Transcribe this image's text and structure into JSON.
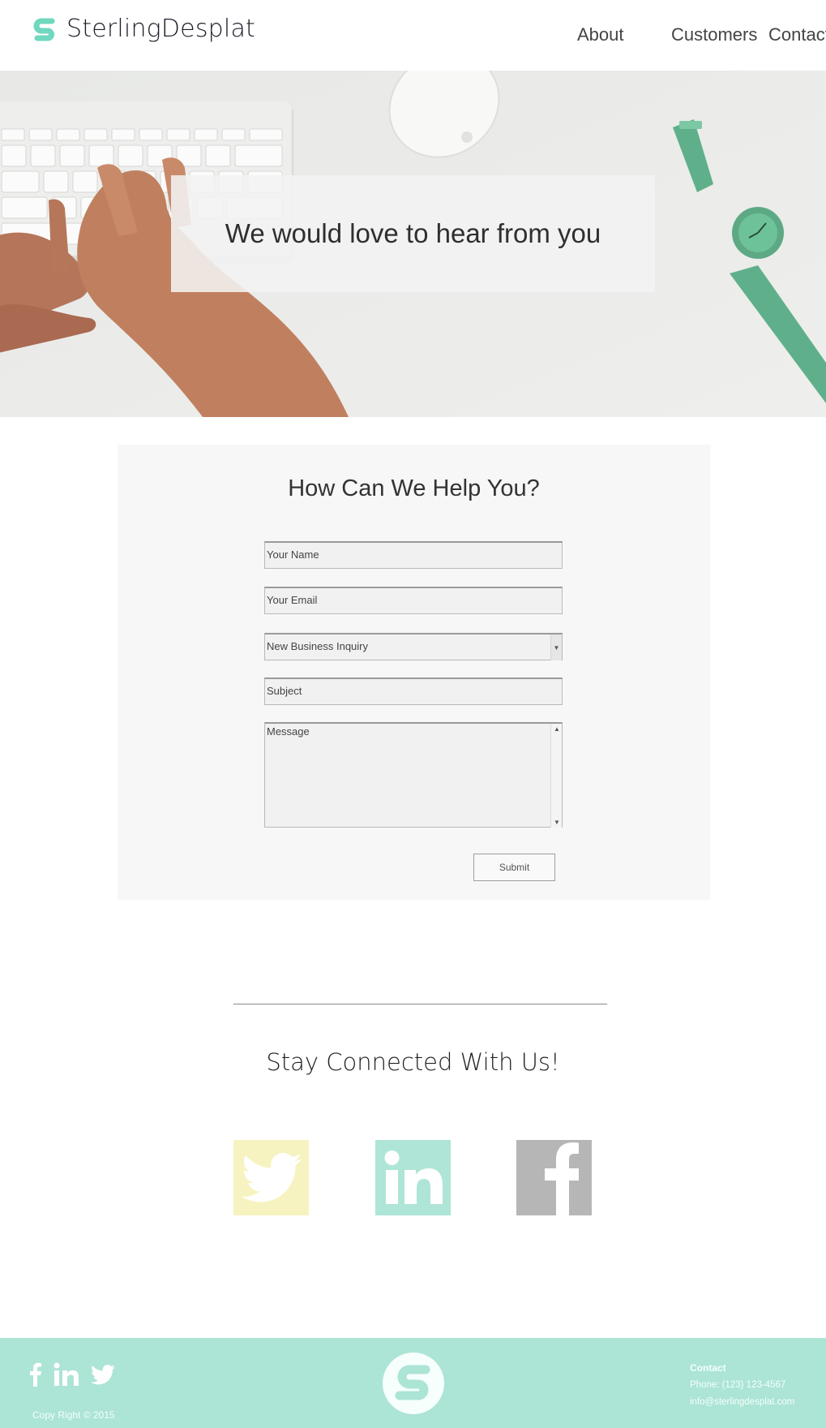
{
  "header": {
    "brand": "SterlingDesplat",
    "nav": [
      "About",
      "Customers",
      "Contact"
    ]
  },
  "hero": {
    "title": "We would love to hear from you"
  },
  "form": {
    "title": "How Can We Help You?",
    "name_placeholder": "Your Name",
    "email_placeholder": "Your Email",
    "inquiry_selected": "New Business Inquiry",
    "subject_placeholder": "Subject",
    "message_placeholder": "Message",
    "submit_label": "Submit"
  },
  "social": {
    "title": "Stay Connected With Us!",
    "tiles": [
      {
        "icon": "twitter-icon",
        "color": "#f6f3c0"
      },
      {
        "icon": "linkedin-icon",
        "color": "#aee5d7"
      },
      {
        "icon": "facebook-icon",
        "color": "#b6b6b6"
      }
    ]
  },
  "footer": {
    "copyright": "Copy Right © 2015",
    "contact_title": "Contact",
    "phone": "Phone: (123) 123-4567",
    "email": "info@sterlingdesplat.com",
    "icons": [
      "facebook-icon",
      "linkedin-icon",
      "twitter-icon"
    ]
  },
  "colors": {
    "brand_mint": "#6fd8bf",
    "footer_bg": "#ace4d6",
    "twitter_tile": "#f6f3c0",
    "linkedin_tile": "#aee5d7",
    "facebook_tile": "#b6b6b6"
  }
}
